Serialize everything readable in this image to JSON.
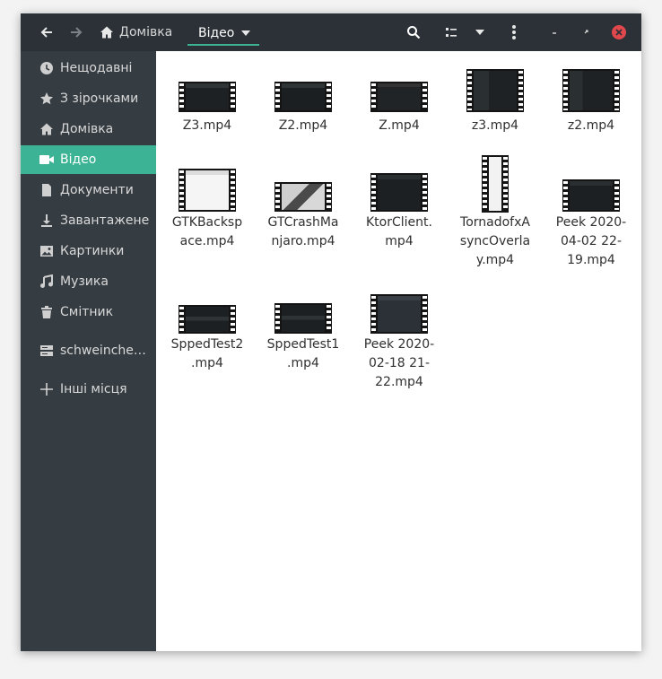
{
  "header": {
    "back_icon": "arrow-left-icon",
    "forward_icon": "arrow-right-icon",
    "home_crumb": "Домівка",
    "current_crumb": "Відео",
    "search_icon": "search-icon",
    "view_icon": "list-view-icon",
    "view_menu_icon": "chevron-down-icon",
    "menu_icon": "kebab-menu-icon",
    "minimize_icon": "minimize-icon",
    "maximize_icon": "maximize-icon",
    "close_icon": "close-icon",
    "accent": "#3cb394",
    "close_color": "#e0484e"
  },
  "sidebar": {
    "items": [
      {
        "label": "Нещодавні",
        "icon": "clock-icon"
      },
      {
        "label": "З зірочками",
        "icon": "star-icon"
      },
      {
        "label": "Домівка",
        "icon": "home-icon"
      },
      {
        "label": "Відео",
        "icon": "video-camera-icon",
        "active": true
      },
      {
        "label": "Документи",
        "icon": "document-icon"
      },
      {
        "label": "Завантажене",
        "icon": "download-icon"
      },
      {
        "label": "Картинки",
        "icon": "image-icon"
      },
      {
        "label": "Музика",
        "icon": "music-icon"
      },
      {
        "label": "Смітник",
        "icon": "trash-icon"
      },
      {
        "label": "schweinche…",
        "icon": "network-drive-icon"
      },
      {
        "label": "Інші місця",
        "icon": "plus-icon"
      }
    ]
  },
  "files": [
    {
      "name_lines": [
        "Z3.mp4"
      ]
    },
    {
      "name_lines": [
        "Z2.mp4"
      ]
    },
    {
      "name_lines": [
        "Z.mp4"
      ]
    },
    {
      "name_lines": [
        "z3.mp4"
      ]
    },
    {
      "name_lines": [
        "z2.mp4"
      ]
    },
    {
      "name_lines": [
        "GTKBacksp",
        "ace.mp4"
      ]
    },
    {
      "name_lines": [
        "GTCrashMa",
        "njaro.mp4"
      ]
    },
    {
      "name_lines": [
        "KtorClient.",
        "mp4"
      ]
    },
    {
      "name_lines": [
        "TornadofxA",
        "syncOverla",
        "y.mp4"
      ]
    },
    {
      "name_lines": [
        "Peek 2020-",
        "04-02 22-",
        "19.mp4"
      ]
    },
    {
      "name_lines": [
        "SppedTest2",
        ".mp4"
      ]
    },
    {
      "name_lines": [
        "SppedTest1",
        ".mp4"
      ]
    },
    {
      "name_lines": [
        "Peek 2020-",
        "02-18 21-",
        "22.mp4"
      ]
    }
  ]
}
